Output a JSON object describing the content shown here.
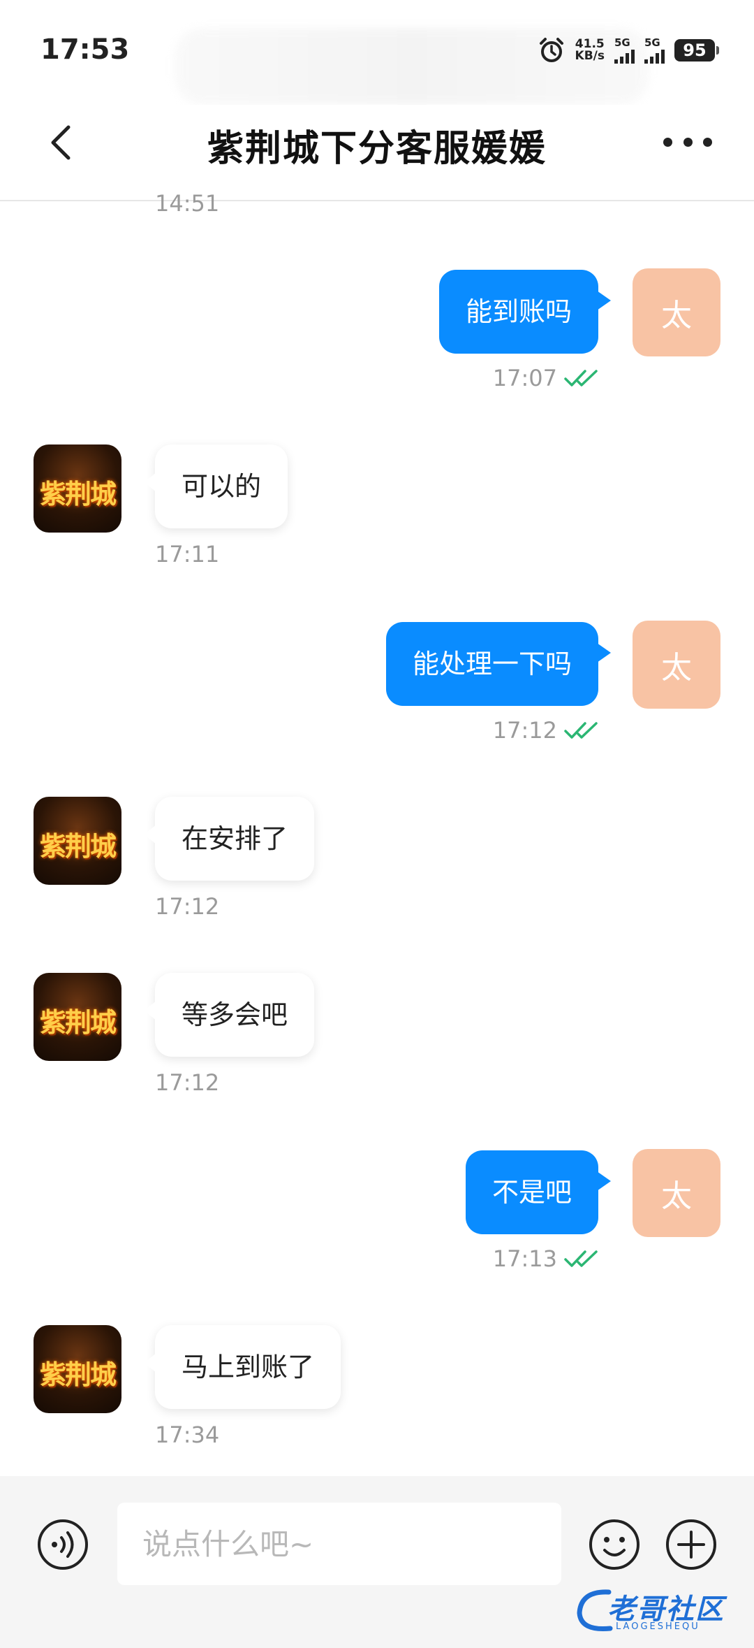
{
  "status_bar": {
    "time": "17:53",
    "net_speed_value": "41.5",
    "net_speed_unit": "KB/s",
    "sim1_label": "5G",
    "sim2_label": "5G",
    "battery": "95"
  },
  "header": {
    "title": "紫荆城下分客服媛媛"
  },
  "partial_timestamp": "14:51",
  "incoming_avatar": {
    "logo_text": "紫荆城"
  },
  "outgoing_avatar": {
    "label": "太"
  },
  "messages": [
    {
      "direction": "out",
      "text": "能到账吗",
      "time": "17:07",
      "status": "read"
    },
    {
      "direction": "in",
      "text": "可以的",
      "time": "17:11"
    },
    {
      "direction": "out",
      "text": "能处理一下吗",
      "time": "17:12",
      "status": "read"
    },
    {
      "direction": "in",
      "text": "在安排了",
      "time": "17:12"
    },
    {
      "direction": "in",
      "text": "等多会吧",
      "time": "17:12"
    },
    {
      "direction": "out",
      "text": "不是吧",
      "time": "17:13",
      "status": "read"
    },
    {
      "direction": "in",
      "text": "马上到账了",
      "time": "17:34"
    }
  ],
  "input_bar": {
    "placeholder": "说点什么吧~",
    "voice_icon": "voice-icon",
    "emoji_icon": "emoji-icon",
    "add_icon": "plus-icon"
  },
  "watermark": {
    "text": "老哥社区",
    "sub": "LAOGESHEQU"
  },
  "colors": {
    "outgoing_bubble": "#0a8cff",
    "outgoing_avatar": "#f8c3a4",
    "read_check": "#2bb673"
  }
}
